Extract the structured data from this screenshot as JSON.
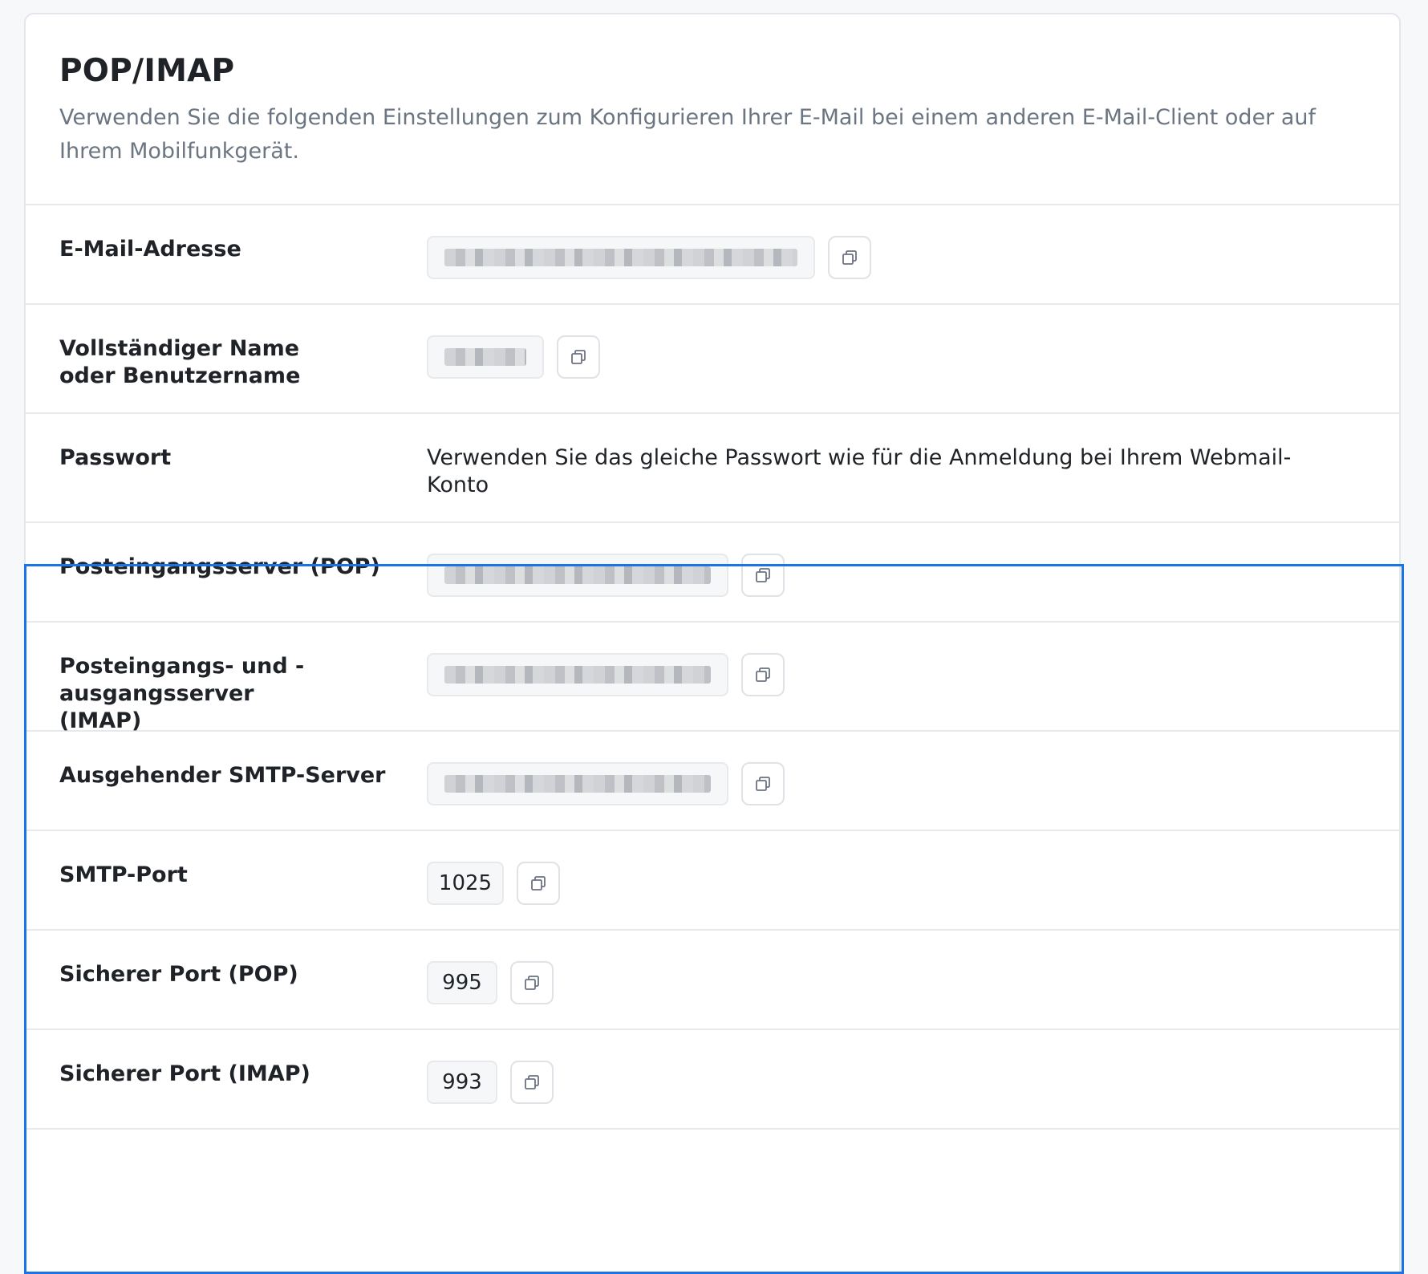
{
  "card": {
    "title": "POP/IMAP",
    "description": "Verwenden Sie die folgenden Einstellungen zum Konfigurieren Ihrer E-Mail bei einem anderen E-Mail-Client oder auf Ihrem Mobilfunkgerät."
  },
  "rows": {
    "email": {
      "label": "E-Mail-Adresse"
    },
    "username": {
      "label": "Vollständiger Name oder Benutzername"
    },
    "password": {
      "label": "Passwort",
      "text": "Verwenden Sie das gleiche Passwort wie für die Anmeldung bei Ihrem Webmail-Konto"
    },
    "pop_server": {
      "label": "Posteingangsserver (POP)"
    },
    "imap_server": {
      "label": "Posteingangs- und -ausgangsserver (IMAP)"
    },
    "smtp_server": {
      "label": "Ausgehender SMTP-Server"
    },
    "smtp_port": {
      "label": "SMTP-Port",
      "value": "1025"
    },
    "secure_pop_port": {
      "label": "Sicherer Port (POP)",
      "value": "995"
    },
    "secure_imap_port": {
      "label": "Sicherer Port (IMAP)",
      "value": "993"
    }
  },
  "icons": {
    "copy": "copy-icon"
  },
  "colors": {
    "highlight": "#1a73e8",
    "muted_text": "#6c7682"
  }
}
